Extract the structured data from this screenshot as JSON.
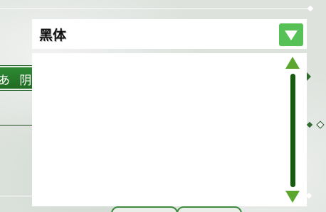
{
  "font_select": {
    "selected_value": "黑体",
    "dropdown_icon": "triangle-down-icon",
    "options": [],
    "scroll_up_icon": "triangle-up-icon",
    "scroll_down_icon": "triangle-down-icon"
  },
  "background": {
    "tab_label": "あ  阴",
    "accent_color": "#56c156",
    "scroll_thumb_color": "#165c0f"
  }
}
